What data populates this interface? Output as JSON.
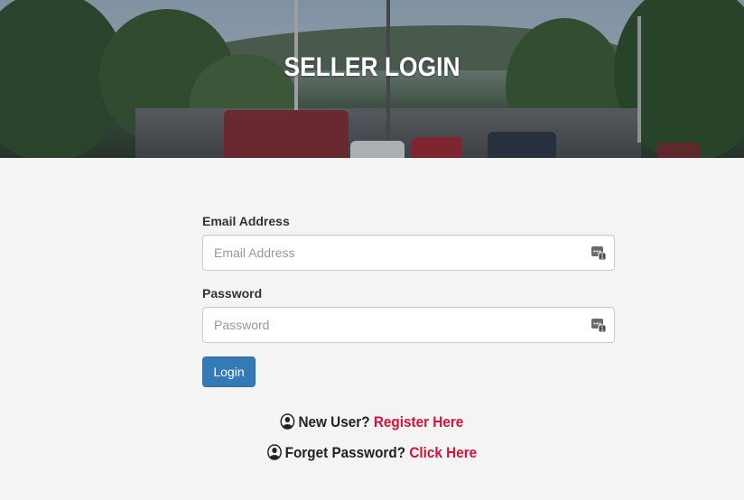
{
  "hero": {
    "title": "SELLER LOGIN"
  },
  "form": {
    "email": {
      "label": "Email Address",
      "placeholder": "Email Address",
      "value": "",
      "icon": "password-manager-icon"
    },
    "password": {
      "label": "Password",
      "placeholder": "Password",
      "value": "",
      "icon": "password-manager-icon"
    },
    "login_label": "Login"
  },
  "links": {
    "new_user": {
      "icon": "user-circle-icon",
      "prompt": "New User?",
      "link_text": "Register Here"
    },
    "forgot": {
      "icon": "user-circle-icon",
      "prompt": "Forget Password?",
      "link_text": "Click Here"
    }
  },
  "colors": {
    "primary_button": "#337ab7",
    "link": "#d2143a",
    "page_background": "#f4f4f4"
  }
}
